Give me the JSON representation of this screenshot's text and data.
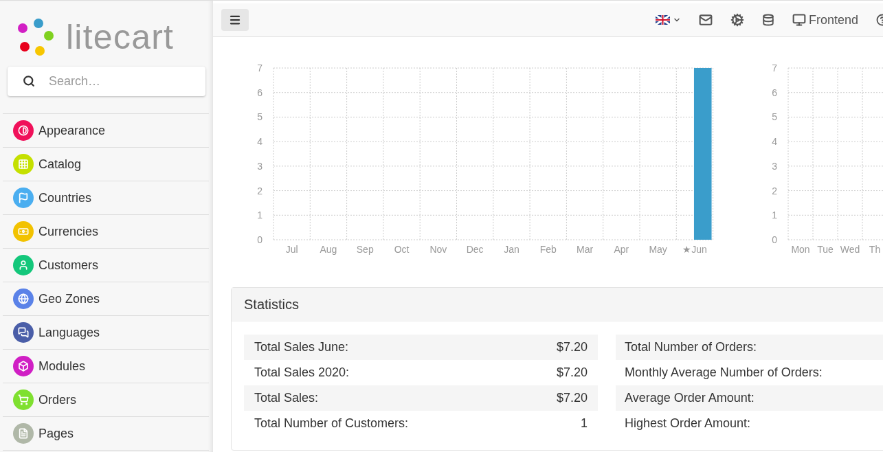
{
  "logo": {
    "text": "litecart"
  },
  "search": {
    "placeholder": "Search…"
  },
  "sidebar": {
    "items": [
      {
        "label": "Appearance",
        "color": "#f0115a"
      },
      {
        "label": "Catalog",
        "color": "#c5e000"
      },
      {
        "label": "Countries",
        "color": "#4aaef0"
      },
      {
        "label": "Currencies",
        "color": "#f2c200"
      },
      {
        "label": "Customers",
        "color": "#14c77b"
      },
      {
        "label": "Geo Zones",
        "color": "#5a82e8"
      },
      {
        "label": "Languages",
        "color": "#4a5ea8"
      },
      {
        "label": "Modules",
        "color": "#d01fc4"
      },
      {
        "label": "Orders",
        "color": "#7fe030"
      },
      {
        "label": "Pages",
        "color": "#b0b8a8"
      }
    ]
  },
  "topbar": {
    "frontend_label": "Frontend"
  },
  "monthly_chart": {
    "chart_data": {
      "type": "bar",
      "categories": [
        "Jul",
        "Aug",
        "Sep",
        "Oct",
        "Nov",
        "Dec",
        "Jan",
        "Feb",
        "Mar",
        "Apr",
        "May",
        "★Jun"
      ],
      "series": [
        {
          "color": "#3a9dcb",
          "values": [
            0,
            0,
            0,
            0,
            0,
            0,
            0,
            0,
            0,
            0,
            0,
            7
          ]
        }
      ],
      "ylim": [
        0,
        7
      ],
      "yticks": [
        0,
        1,
        2,
        3,
        4,
        5,
        6,
        7
      ],
      "grid": true
    }
  },
  "weekday_chart": {
    "chart_data": {
      "type": "bar",
      "categories": [
        "Mon",
        "Tue",
        "Wed",
        "Th"
      ],
      "values": [
        0,
        0,
        0,
        0
      ],
      "ylim": [
        0,
        7
      ],
      "yticks": [
        0,
        1,
        2,
        3,
        4,
        5,
        6,
        7
      ],
      "grid": true
    }
  },
  "statistics": {
    "title": "Statistics",
    "left_rows": [
      {
        "label": "Total Sales June:",
        "value": "$7.20"
      },
      {
        "label": "Total Sales 2020:",
        "value": "$7.20"
      },
      {
        "label": "Total Sales:",
        "value": "$7.20"
      },
      {
        "label": "Total Number of Customers:",
        "value": "1"
      }
    ],
    "right_rows": [
      {
        "label": "Total Number of Orders:"
      },
      {
        "label": "Monthly Average Number of Orders:"
      },
      {
        "label": "Average Order Amount:"
      },
      {
        "label": "Highest Order Amount:"
      }
    ]
  }
}
